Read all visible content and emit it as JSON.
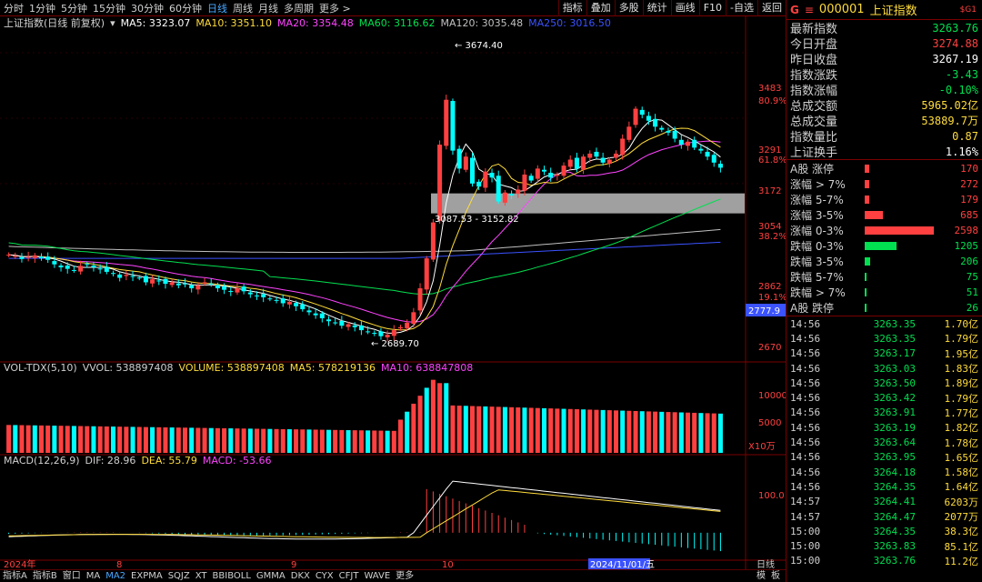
{
  "toolbar": {
    "periods": [
      "分时",
      "1分钟",
      "5分钟",
      "15分钟",
      "30分钟",
      "60分钟",
      "日线",
      "周线",
      "月线",
      "多周期",
      "更多 >"
    ],
    "active_period": "日线",
    "right_buttons": [
      "指标",
      "叠加",
      "多股",
      "统计",
      "画线",
      "F10",
      "-自选",
      "返回"
    ]
  },
  "main_legend": {
    "title": "上证指数(日线 前复权)",
    "items": [
      {
        "text": "MA5: 3323.07",
        "color": "#ffffff"
      },
      {
        "text": "MA10: 3351.10",
        "color": "#ffdc3c"
      },
      {
        "text": "MA20: 3354.48",
        "color": "#ff44ff"
      },
      {
        "text": "MA60: 3116.62",
        "color": "#00e050"
      },
      {
        "text": "MA120: 3035.48",
        "color": "#c0c0c0"
      },
      {
        "text": "MA250: 3016.50",
        "color": "#3a52ff"
      }
    ]
  },
  "vol_legend": {
    "title": "VOL-TDX(5,10)",
    "items": [
      {
        "text": "VVOL: 538897408",
        "color": "#d0d0d0"
      },
      {
        "text": "VOLUME: 538897408",
        "color": "#ffdc3c"
      },
      {
        "text": "MA5: 578219136",
        "color": "#ffdc3c"
      },
      {
        "text": "MA10: 638847808",
        "color": "#ff44ff"
      }
    ]
  },
  "macd_legend": {
    "title": "MACD(12,26,9)",
    "items": [
      {
        "text": "DIF: 28.96",
        "color": "#d0d0d0"
      },
      {
        "text": "DEA: 55.79",
        "color": "#ffdc3c"
      },
      {
        "text": "MACD: -53.66",
        "color": "#ff44ff"
      }
    ]
  },
  "chart_labels": {
    "high": "3674.40",
    "low": "2689.70",
    "gap": "3087.53 - 3152.82",
    "cursor_price": "2777.9",
    "vol_unit": "X10万",
    "date_cursor": "2024/11/01/五",
    "date_ticks": [
      "2024年",
      "8",
      "9",
      "10"
    ],
    "right_axis_label": "日线"
  },
  "price_axis": [
    {
      "text": "3483",
      "color": "#ff4040"
    },
    {
      "text": "80.9%",
      "color": "#ff4040"
    },
    {
      "text": "3291",
      "color": "#ff4040"
    },
    {
      "text": "61.8%",
      "color": "#ff4040"
    },
    {
      "text": "3172",
      "color": "#ff4040"
    },
    {
      "text": "3054",
      "color": "#ff4040"
    },
    {
      "text": "38.2%",
      "color": "#ff4040"
    },
    {
      "text": "2862",
      "color": "#ff4040"
    },
    {
      "text": "19.1%",
      "color": "#ff4040"
    },
    {
      "text": "2670",
      "color": "#ff4040"
    }
  ],
  "vol_axis": [
    "10000",
    "5000"
  ],
  "macd_axis": [
    "100.0"
  ],
  "quote": {
    "g": "G",
    "menu": "≡",
    "code": "000001",
    "name": "上证指数",
    "sg": "$G1",
    "rows": [
      {
        "label": "最新指数",
        "value": "3263.76",
        "color": "#00e050"
      },
      {
        "label": "今日开盘",
        "value": "3274.88",
        "color": "#ff4040"
      },
      {
        "label": "昨日收盘",
        "value": "3267.19",
        "color": "#ffffff"
      },
      {
        "label": "指数涨跌",
        "value": "-3.43",
        "color": "#00e050"
      },
      {
        "label": "指数涨幅",
        "value": "-0.10%",
        "color": "#00e050"
      },
      {
        "label": "总成交额",
        "value": "5965.02亿",
        "color": "#ffdc3c"
      },
      {
        "label": "总成交量",
        "value": "53889.7万",
        "color": "#ffdc3c"
      },
      {
        "label": "指数量比",
        "value": "0.87",
        "color": "#ffdc3c"
      },
      {
        "label": "上证换手",
        "value": "1.16%",
        "color": "#ffffff"
      }
    ]
  },
  "distribution": [
    {
      "label": "A股 涨停",
      "count": "170",
      "bar": 0.07,
      "color": "#ff4040"
    },
    {
      "label": "涨幅 > 7%",
      "count": "272",
      "bar": 0.06,
      "color": "#ff4040"
    },
    {
      "label": "涨幅 5-7%",
      "count": "179",
      "bar": 0.07,
      "color": "#ff4040"
    },
    {
      "label": "涨幅 3-5%",
      "count": "685",
      "bar": 0.26,
      "color": "#ff4040"
    },
    {
      "label": "涨幅 0-3%",
      "count": "2598",
      "bar": 1.0,
      "color": "#ff4040"
    },
    {
      "label": "跌幅 0-3%",
      "count": "1205",
      "bar": 0.46,
      "color": "#00e050"
    },
    {
      "label": "跌幅 3-5%",
      "count": "206",
      "bar": 0.08,
      "color": "#00e050"
    },
    {
      "label": "跌幅 5-7%",
      "count": "75",
      "bar": 0.03,
      "color": "#00e050"
    },
    {
      "label": "跌幅 > 7%",
      "count": "51",
      "bar": 0.02,
      "color": "#00e050"
    },
    {
      "label": "A股 跌停",
      "count": "26",
      "bar": 0.01,
      "color": "#00e050"
    }
  ],
  "ticks": [
    {
      "time": "14:56",
      "price": "3263.35",
      "vol": "1.70亿"
    },
    {
      "time": "14:56",
      "price": "3263.35",
      "vol": "1.79亿"
    },
    {
      "time": "14:56",
      "price": "3263.17",
      "vol": "1.95亿"
    },
    {
      "time": "14:56",
      "price": "3263.03",
      "vol": "1.83亿"
    },
    {
      "time": "14:56",
      "price": "3263.50",
      "vol": "1.89亿"
    },
    {
      "time": "14:56",
      "price": "3263.42",
      "vol": "1.79亿"
    },
    {
      "time": "14:56",
      "price": "3263.91",
      "vol": "1.77亿"
    },
    {
      "time": "14:56",
      "price": "3263.19",
      "vol": "1.82亿"
    },
    {
      "time": "14:56",
      "price": "3263.64",
      "vol": "1.78亿"
    },
    {
      "time": "14:56",
      "price": "3263.95",
      "vol": "1.65亿"
    },
    {
      "time": "14:56",
      "price": "3264.18",
      "vol": "1.58亿"
    },
    {
      "time": "14:56",
      "price": "3264.35",
      "vol": "1.64亿"
    },
    {
      "time": "14:57",
      "price": "3264.41",
      "vol": "6203万"
    },
    {
      "time": "14:57",
      "price": "3264.47",
      "vol": "2077万"
    },
    {
      "time": "15:00",
      "price": "3264.35",
      "vol": "38.3亿"
    },
    {
      "time": "15:00",
      "price": "3263.83",
      "vol": "85.1亿"
    },
    {
      "time": "15:00",
      "price": "3263.76",
      "vol": "11.2亿"
    }
  ],
  "bottom_tabs": [
    "指标A",
    "指标B",
    "窗口",
    "MA",
    "MA2",
    "EXPMA",
    "SQJZ",
    "XT",
    "BBIBOLL",
    "GMMA",
    "DKX",
    "CYX",
    "CFJT",
    "WAVE",
    "更多"
  ],
  "bottom_active": "MA2",
  "bottom_right": [
    "模",
    "板"
  ],
  "chart_data": {
    "type": "candlestick",
    "title": "上证指数(日线 前复权)",
    "ylim": [
      2620,
      3720
    ],
    "high_label": 3674.4,
    "low_label": 2689.7,
    "gap_zone": [
      3087.53,
      3152.82
    ],
    "closes": [
      2972,
      2968,
      2958,
      2965,
      2970,
      2960,
      2955,
      2940,
      2930,
      2925,
      2920,
      2935,
      2940,
      2930,
      2925,
      2915,
      2910,
      2895,
      2905,
      2900,
      2895,
      2880,
      2890,
      2885,
      2875,
      2880,
      2870,
      2875,
      2860,
      2870,
      2880,
      2875,
      2860,
      2855,
      2850,
      2860,
      2850,
      2840,
      2835,
      2830,
      2825,
      2820,
      2810,
      2815,
      2800,
      2790,
      2780,
      2770,
      2760,
      2750,
      2745,
      2735,
      2740,
      2730,
      2720,
      2715,
      2710,
      2700,
      2705,
      2720,
      2730,
      2745,
      2780,
      2860,
      2960,
      3080,
      3340,
      3490,
      3320,
      3260,
      3300,
      3210,
      3200,
      3250,
      3230,
      3150,
      3180,
      3170,
      3190,
      3240,
      3220,
      3260,
      3250,
      3230,
      3240,
      3270,
      3290,
      3260,
      3300,
      3310,
      3300,
      3280,
      3290,
      3310,
      3360,
      3400,
      3460,
      3440,
      3420,
      3400,
      3390,
      3380,
      3360,
      3340,
      3350,
      3330,
      3320,
      3300,
      3280,
      3263
    ],
    "vol_ylim": [
      0,
      11500
    ],
    "macd_ylim": [
      -60,
      160
    ]
  }
}
